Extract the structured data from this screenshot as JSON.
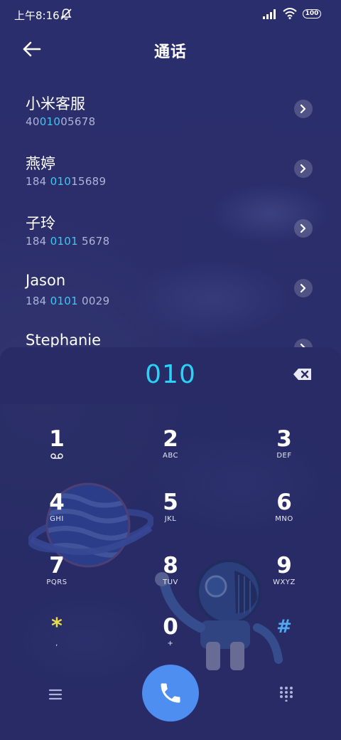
{
  "status_bar": {
    "time": "上午8:16",
    "battery": "100",
    "icons": [
      "mute-icon",
      "signal-icon",
      "wifi-icon",
      "battery-icon"
    ]
  },
  "header": {
    "title": "通话",
    "back_icon": "arrow-left-icon"
  },
  "results": [
    {
      "name": "小米客服",
      "number_parts": [
        "40",
        "010",
        "05678"
      ]
    },
    {
      "name": "燕婷",
      "number_parts": [
        "184 ",
        "010",
        "15689"
      ]
    },
    {
      "name": "子玲",
      "number_parts": [
        "184 ",
        "0101",
        " 5678"
      ]
    },
    {
      "name": "Jason",
      "number_parts": [
        "184 ",
        "0101",
        " 0029"
      ]
    },
    {
      "name": "Stephanie",
      "number_parts": [
        "",
        "",
        ""
      ]
    }
  ],
  "dialer": {
    "dialed": "010",
    "backspace_icon": "backspace-icon"
  },
  "keypad": [
    {
      "digit": "1",
      "letters": "",
      "icon": "voicemail-icon"
    },
    {
      "digit": "2",
      "letters": "ABC"
    },
    {
      "digit": "3",
      "letters": "DEF"
    },
    {
      "digit": "4",
      "letters": "GHI"
    },
    {
      "digit": "5",
      "letters": "JKL"
    },
    {
      "digit": "6",
      "letters": "MNO"
    },
    {
      "digit": "7",
      "letters": "PQRS"
    },
    {
      "digit": "8",
      "letters": "TUV"
    },
    {
      "digit": "9",
      "letters": "WXYZ"
    },
    {
      "digit": "*",
      "letters": ","
    },
    {
      "digit": "0",
      "letters": "+"
    },
    {
      "digit": "#",
      "letters": ""
    }
  ],
  "bottom_bar": {
    "menu_icon": "menu-icon",
    "call_icon": "phone-icon",
    "keypad_icon": "dialpad-icon"
  },
  "colors": {
    "background": "#2a2d6a",
    "dialed_accent": "#28d3f5",
    "match_highlight": "#3fc6f3",
    "call_button": "#4d8ef0",
    "star_key": "#e8dd4a",
    "hash_key": "#4fa8f0"
  }
}
